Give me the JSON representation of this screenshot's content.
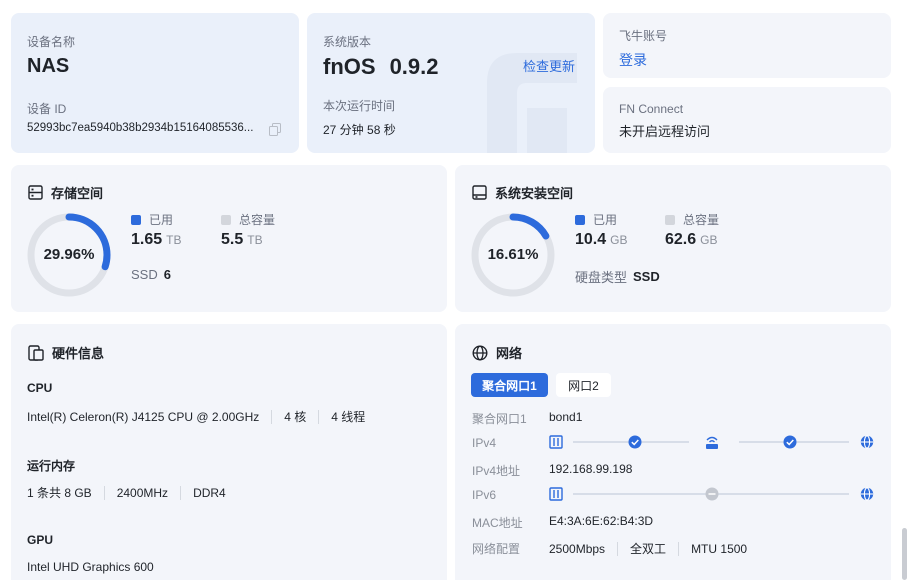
{
  "device": {
    "name_label": "设备名称",
    "name": "NAS",
    "id_label": "设备 ID",
    "id": "52993bc7ea5940b38b2934b15164085536..."
  },
  "system": {
    "version_label": "系统版本",
    "version": "fnOS",
    "version_number": "0.9.2",
    "check_update": "检查更新",
    "uptime_label": "本次运行时间",
    "uptime": "27 分钟 58 秒"
  },
  "account": {
    "label": "飞牛账号",
    "login": "登录"
  },
  "connect": {
    "label": "FN Connect",
    "status": "未开启远程访问"
  },
  "storage": {
    "title": "存储空间",
    "percent": "29.96%",
    "used_fraction": 0.2996,
    "used_label": "已用",
    "used_value": "1.65",
    "used_unit": "TB",
    "total_label": "总容量",
    "total_value": "5.5",
    "total_unit": "TB",
    "ssd_label": "SSD",
    "ssd_count": "6"
  },
  "sysdisk": {
    "title": "系统安装空间",
    "percent": "16.61%",
    "used_fraction": 0.1661,
    "used_label": "已用",
    "used_value": "10.4",
    "used_unit": "GB",
    "total_label": "总容量",
    "total_value": "62.6",
    "total_unit": "GB",
    "disk_type_label": "硬盘类型",
    "disk_type": "SSD"
  },
  "hardware": {
    "title": "硬件信息",
    "cpu_label": "CPU",
    "cpu_model": "Intel(R) Celeron(R) J4125 CPU @ 2.00GHz",
    "cpu_cores": "4 核",
    "cpu_threads": "4 线程",
    "ram_label": "运行内存",
    "ram_size": "1 条共 8 GB",
    "ram_speed": "2400MHz",
    "ram_type": "DDR4",
    "gpu_label": "GPU",
    "gpu_model": "Intel UHD Graphics 600"
  },
  "network": {
    "title": "网络",
    "tabs": [
      "聚合网口1",
      "网口2"
    ],
    "iface_label": "聚合网口1",
    "iface_value": "bond1",
    "ipv4_label": "IPv4",
    "ipv4_addr_label": "IPv4地址",
    "ipv4_addr": "192.168.99.198",
    "ipv6_label": "IPv6",
    "mac_label": "MAC地址",
    "mac": "E4:3A:6E:62:B4:3D",
    "config_label": "网络配置",
    "speed": "2500Mbps",
    "duplex": "全双工",
    "mtu": "MTU 1500"
  },
  "colors": {
    "accent": "#2d6bdc",
    "ring_track": "#dfe2e8",
    "total_swatch": "#d3d6dc",
    "card_bg": "#f3f5fa",
    "tinted_card_bg": "#eaf0fa"
  }
}
